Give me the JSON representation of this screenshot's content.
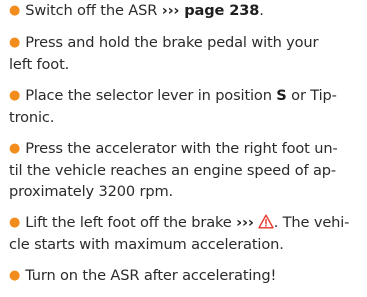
{
  "colors": {
    "bullet": "#f28c1c",
    "warning_icon": "#e8342b",
    "text": "#2b2b2b"
  },
  "steps": [
    {
      "lines": [
        "Switch off the ASR "
      ],
      "ref": "››› page 238",
      "ref_tail": "."
    },
    {
      "lines": [
        "Press and hold the brake pedal with your",
        "left foot."
      ]
    },
    {
      "line1_before": "Place the selector lever in position ",
      "bold": "S",
      "line1_after": " or Tip-",
      "line2": "tronic."
    },
    {
      "lines": [
        "Press the accelerator with the right foot un-",
        "til the vehicle reaches an engine speed of ap-",
        "proximately 3200 rpm."
      ]
    },
    {
      "line1_before": "Lift the left foot off the brake ",
      "ref": "›››",
      "icon": "warning-triangle-icon",
      "line1_after": ". The vehi-",
      "line2": "cle starts with maximum acceleration."
    },
    {
      "lines": [
        "Turn on the ASR after accelerating!"
      ]
    }
  ]
}
